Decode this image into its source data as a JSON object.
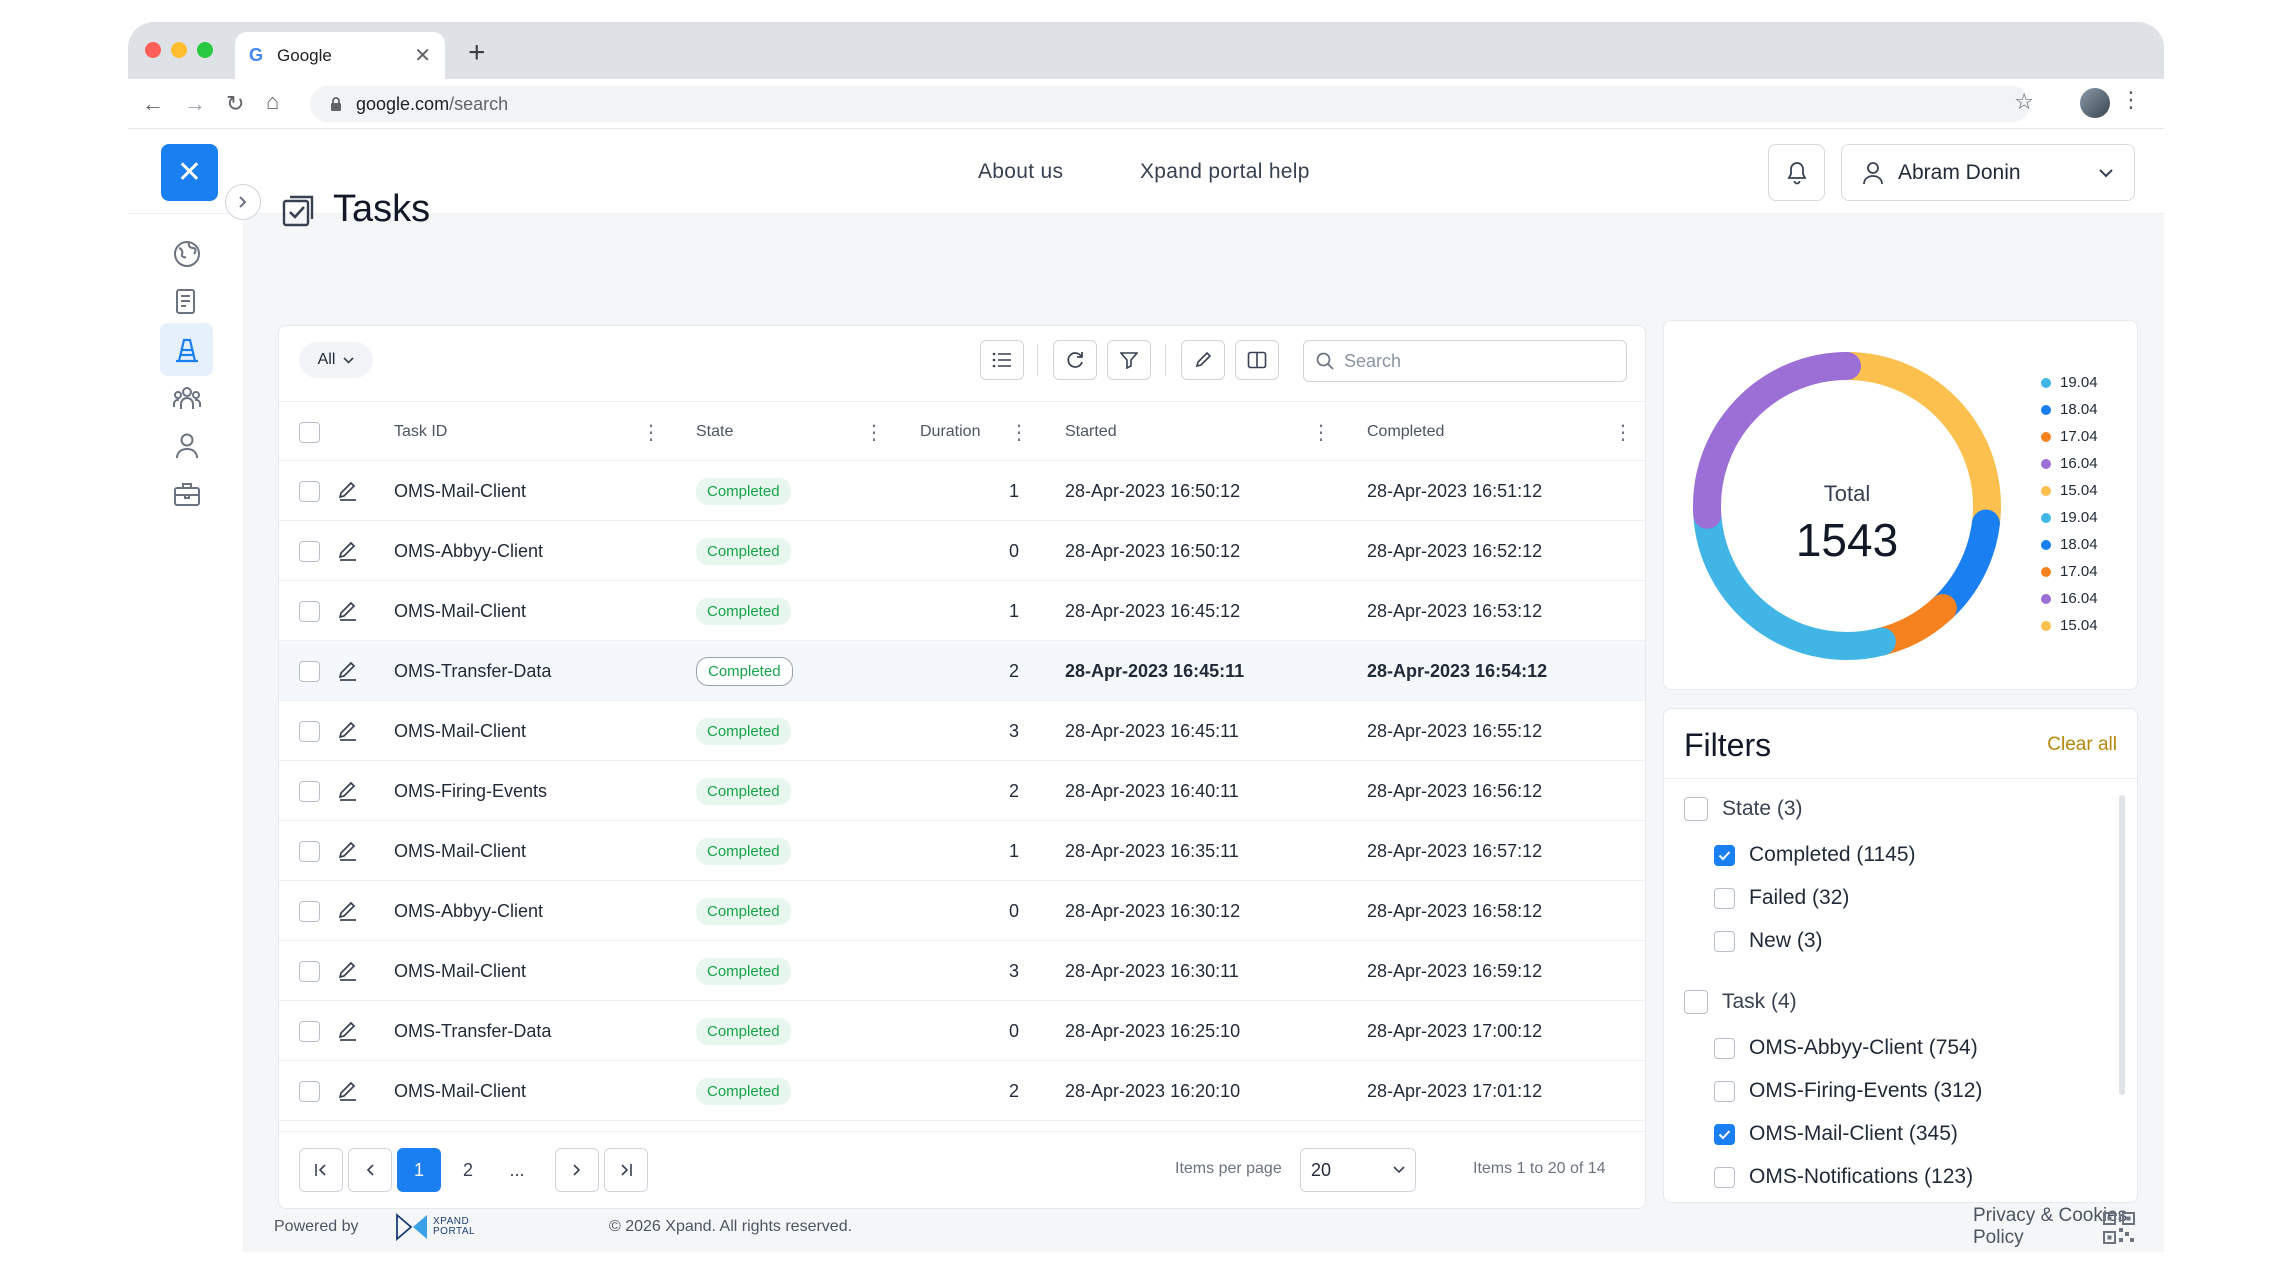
{
  "browser": {
    "tab_title": "Google",
    "tab_favicon": "G",
    "url_domain": "google.com",
    "url_path": "/search",
    "traffic_colors": [
      "#ff5f57",
      "#febc2e",
      "#28c840"
    ]
  },
  "header": {
    "links": [
      "About us",
      "Xpand portal help"
    ],
    "user_name": "Abram Donin"
  },
  "page": {
    "title": "Tasks"
  },
  "toolbar": {
    "filter_all": "All",
    "search_placeholder": "Search"
  },
  "table": {
    "columns": [
      "Task ID",
      "State",
      "Duration",
      "Started",
      "Completed"
    ],
    "rows": [
      {
        "task_id": "OMS-Mail-Client",
        "state": "Completed",
        "duration": "1",
        "started": "28-Apr-2023 16:50:12",
        "completed": "28-Apr-2023 16:51:12"
      },
      {
        "task_id": "OMS-Abbyy-Client",
        "state": "Completed",
        "duration": "0",
        "started": "28-Apr-2023 16:50:12",
        "completed": "28-Apr-2023 16:52:12"
      },
      {
        "task_id": "OMS-Mail-Client",
        "state": "Completed",
        "duration": "1",
        "started": "28-Apr-2023 16:45:12",
        "completed": "28-Apr-2023 16:53:12"
      },
      {
        "task_id": "OMS-Transfer-Data",
        "state": "Completed",
        "duration": "2",
        "started": "28-Apr-2023 16:45:11",
        "completed": "28-Apr-2023 16:54:12"
      },
      {
        "task_id": "OMS-Mail-Client",
        "state": "Completed",
        "duration": "3",
        "started": "28-Apr-2023 16:45:11",
        "completed": "28-Apr-2023 16:55:12"
      },
      {
        "task_id": "OMS-Firing-Events",
        "state": "Completed",
        "duration": "2",
        "started": "28-Apr-2023 16:40:11",
        "completed": "28-Apr-2023 16:56:12"
      },
      {
        "task_id": "OMS-Mail-Client",
        "state": "Completed",
        "duration": "1",
        "started": "28-Apr-2023 16:35:11",
        "completed": "28-Apr-2023 16:57:12"
      },
      {
        "task_id": "OMS-Abbyy-Client",
        "state": "Completed",
        "duration": "0",
        "started": "28-Apr-2023 16:30:12",
        "completed": "28-Apr-2023 16:58:12"
      },
      {
        "task_id": "OMS-Mail-Client",
        "state": "Completed",
        "duration": "3",
        "started": "28-Apr-2023 16:30:11",
        "completed": "28-Apr-2023 16:59:12"
      },
      {
        "task_id": "OMS-Transfer-Data",
        "state": "Completed",
        "duration": "0",
        "started": "28-Apr-2023 16:25:10",
        "completed": "28-Apr-2023 17:00:12"
      },
      {
        "task_id": "OMS-Mail-Client",
        "state": "Completed",
        "duration": "2",
        "started": "28-Apr-2023 16:20:10",
        "completed": "28-Apr-2023 17:01:12"
      }
    ]
  },
  "pagination": {
    "pages": [
      "1",
      "2",
      "..."
    ],
    "items_per_page_label": "Items per page",
    "items_per_page": "20",
    "summary": "Items 1 to 20 of 14"
  },
  "chart_data": {
    "type": "pie",
    "center_label": "Total",
    "center_value": "1543",
    "categories": [
      "19.04",
      "18.04",
      "17.04",
      "16.04",
      "15.04",
      "19.04",
      "18.04",
      "17.04",
      "16.04",
      "15.04"
    ],
    "colors": [
      "#41b6e6",
      "#1a7ff0",
      "#f5821f",
      "#9b6fd6",
      "#fbc04e",
      "#41b6e6",
      "#1a7ff0",
      "#f5821f",
      "#9b6fd6",
      "#fbc04e"
    ],
    "segments": [
      {
        "name": "15.04",
        "value": 27,
        "color": "#fbc04e"
      },
      {
        "name": "18.04",
        "value": 11,
        "color": "#1a7ff0"
      },
      {
        "name": "17.04",
        "value": 8,
        "color": "#f5821f"
      },
      {
        "name": "19.04",
        "value": 28,
        "color": "#41b6e6"
      },
      {
        "name": "16.04",
        "value": 26,
        "color": "#9b6fd6"
      }
    ]
  },
  "filters": {
    "title": "Filters",
    "clear_all": "Clear all",
    "groups": [
      {
        "label": "State (3)",
        "options": [
          {
            "label": "Completed (1145)",
            "checked": true
          },
          {
            "label": "Failed (32)",
            "checked": false
          },
          {
            "label": "New (3)",
            "checked": false
          }
        ]
      },
      {
        "label": "Task (4)",
        "options": [
          {
            "label": "OMS-Abbyy-Client (754)",
            "checked": false
          },
          {
            "label": "OMS-Firing-Events (312)",
            "checked": false
          },
          {
            "label": "OMS-Mail-Client (345)",
            "checked": true
          },
          {
            "label": "OMS-Notifications (123)",
            "checked": false
          }
        ]
      }
    ]
  },
  "footer": {
    "powered_by": "Powered by",
    "logo_text_1": "XPAND",
    "logo_text_2": "PORTAL",
    "copyright": "© 2026 Xpand. All rights reserved.",
    "privacy": "Privacy & Cookies Policy"
  },
  "colors": {
    "accent": "#1a7ff0",
    "success": "#16a34a",
    "gold": "#b7860b"
  }
}
